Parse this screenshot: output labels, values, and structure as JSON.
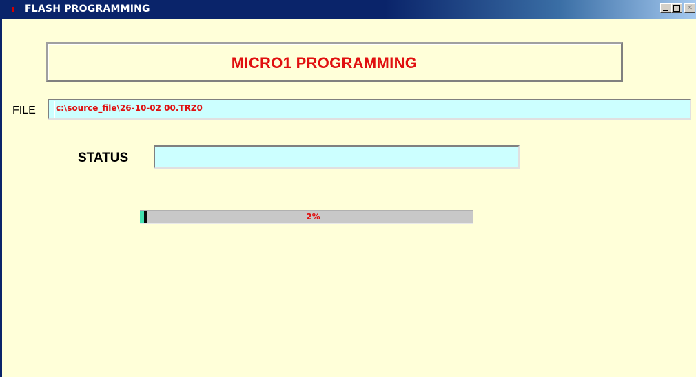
{
  "window": {
    "title": "FLASH PROGRAMMING",
    "background_color": "#ffffd9",
    "titlebar_color": "#0a246a",
    "controls": [
      "minimize-icon",
      "maximize-icon",
      "close-icon"
    ]
  },
  "header": {
    "title": "MICRO1 PROGRAMMING",
    "title_color": "#e01010"
  },
  "file": {
    "label": "FILE",
    "value": "c:\\source_file\\26-10-02 00.TRZ0",
    "field_color": "#ccffff"
  },
  "status": {
    "label": "STATUS",
    "value": ""
  },
  "progress": {
    "value_percent": 2,
    "label": "2%",
    "fill_color": "#44e0b0",
    "text_color": "#e01010"
  }
}
